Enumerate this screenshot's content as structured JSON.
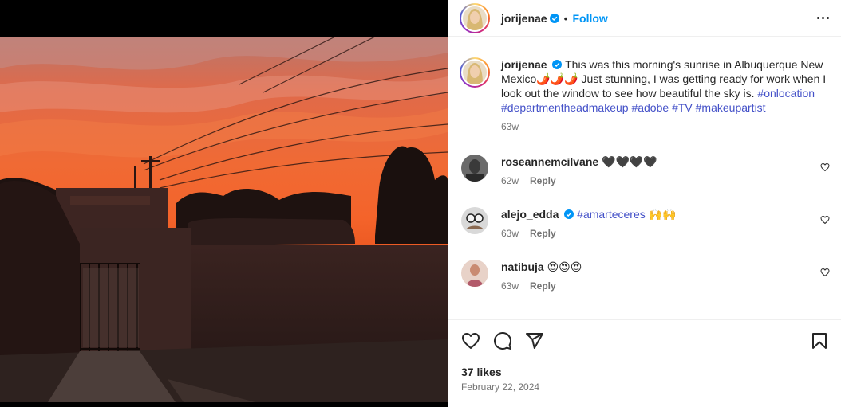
{
  "header": {
    "username": "jorijenae",
    "separator": "•",
    "follow_label": "Follow"
  },
  "caption": {
    "username": "jorijenae",
    "text_before": "This was this morning's sunrise in Albuquerque New Mexico",
    "emoji": "🌶️🌶️🌶️",
    "text_after": " Just stunning, I was getting ready for work when I look out the window to see how beautiful the sky is. ",
    "hashtags": [
      "#onlocation",
      "#departmentheadmakeup",
      "#adobe",
      "#TV",
      "#makeupartist"
    ],
    "time": "63w"
  },
  "comments": [
    {
      "username": "roseannemcilvane",
      "text": "🖤🖤🖤🖤",
      "time": "62w",
      "reply": "Reply",
      "verified": false
    },
    {
      "username": "alejo_edda",
      "text": "#amarteceres",
      "extra": "🙌🙌",
      "time": "63w",
      "reply": "Reply",
      "verified": true
    },
    {
      "username": "natibuja",
      "text": "😍😍😍",
      "time": "63w",
      "reply": "Reply",
      "verified": false
    }
  ],
  "footer": {
    "likes": "37 likes",
    "date": "February 22, 2024"
  },
  "colors": {
    "accent": "#0095f6",
    "hashtag": "#4350c8",
    "verified": "#0095f6",
    "muted": "#737373"
  },
  "icons": [
    "more-icon",
    "verified-icon",
    "heart-icon",
    "comment-icon",
    "share-icon",
    "bookmark-icon",
    "heart-small-icon"
  ]
}
